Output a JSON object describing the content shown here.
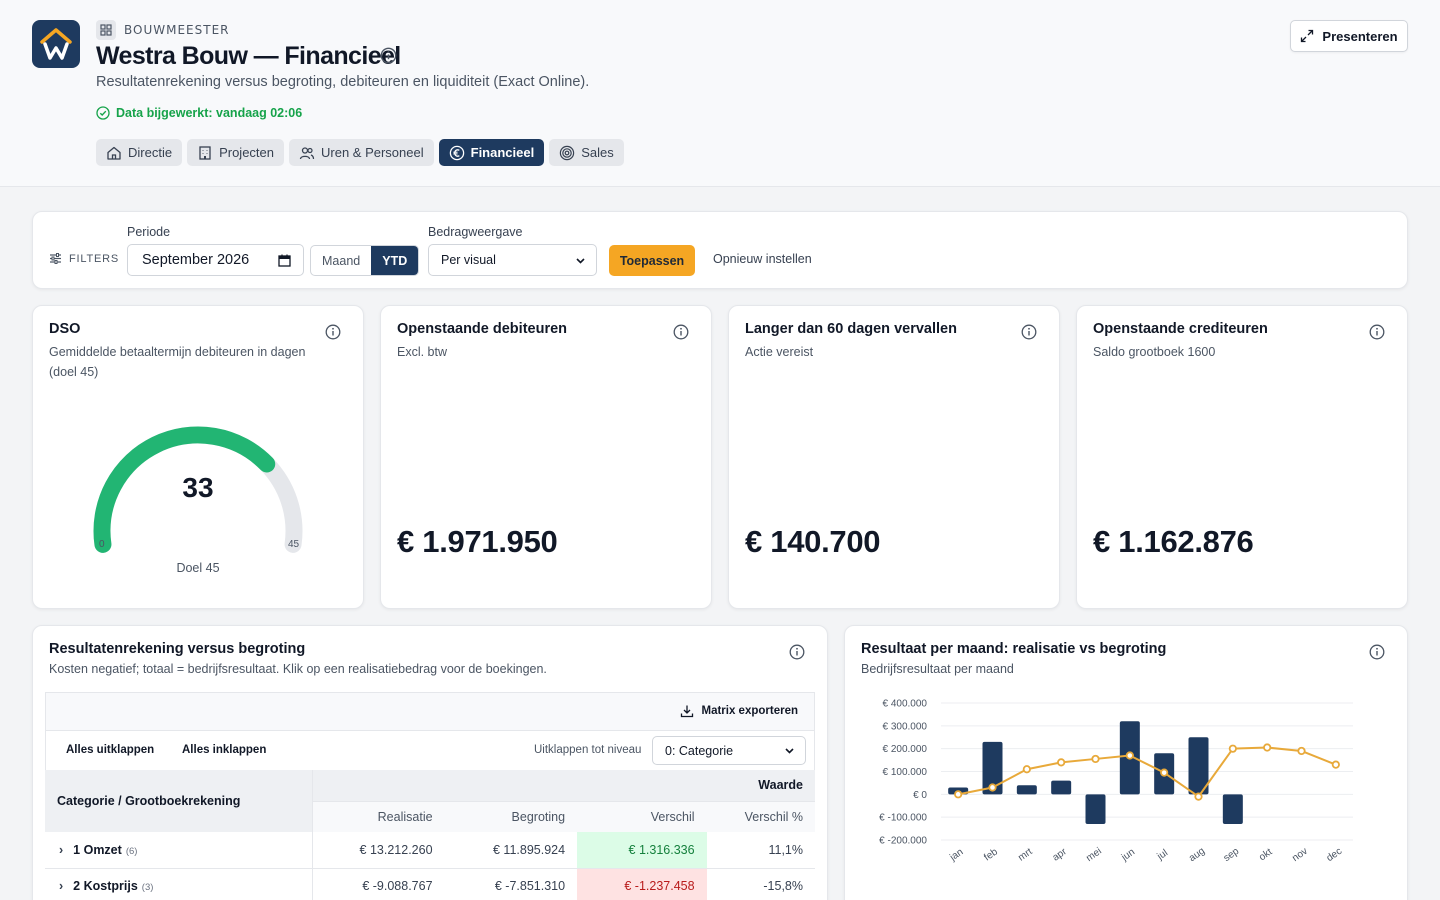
{
  "header": {
    "brand": "BOUWMEESTER",
    "title": "Westra Bouw — Financieel",
    "subtitle": "Resultatenrekening versus begroting, debiteuren en liquiditeit (Exact Online).",
    "updated": "Data bijgewerkt: vandaag 02:06",
    "present_label": "Presenteren",
    "tabs": [
      {
        "label": "Directie",
        "icon": "home-icon",
        "active": false
      },
      {
        "label": "Projecten",
        "icon": "building-icon",
        "active": false
      },
      {
        "label": "Uren & Personeel",
        "icon": "users-icon",
        "active": false
      },
      {
        "label": "Financieel",
        "icon": "euro-icon",
        "active": true
      },
      {
        "label": "Sales",
        "icon": "target-icon",
        "active": false
      }
    ]
  },
  "filters": {
    "label": "FILTERS",
    "period_label": "Periode",
    "period_value": "September 2026",
    "mode_options": [
      "Maand",
      "YTD"
    ],
    "mode_selected": "YTD",
    "amount_label": "Bedragweergave",
    "amount_value": "Per visual",
    "apply_label": "Toepassen",
    "reset_label": "Opnieuw instellen"
  },
  "kpis": {
    "dso": {
      "title": "DSO",
      "subtitle": "Gemiddelde betaaltermijn debiteuren in dagen (doel 45)",
      "value": "33",
      "min": "0",
      "max": "45",
      "target": "Doel 45",
      "fraction": 0.7333
    },
    "debiteuren": {
      "title": "Openstaande debiteuren",
      "subtitle": "Excl. btw",
      "value": "€ 1.971.950"
    },
    "vervallen": {
      "title": "Langer dan 60 dagen vervallen",
      "subtitle": "Actie vereist",
      "value": "€ 140.700"
    },
    "crediteuren": {
      "title": "Openstaande crediteuren",
      "subtitle": "Saldo grootboek 1600",
      "value": "€ 1.162.876"
    }
  },
  "matrix": {
    "title": "Resultatenrekening versus begroting",
    "subtitle": "Kosten negatief; totaal = bedrijfsresultaat. Klik op een realisatiebedrag voor de boekingen.",
    "export_label": "Matrix exporteren",
    "expand_all": "Alles uitklappen",
    "collapse_all": "Alles inklappen",
    "level_label": "Uitklappen tot niveau",
    "level_value": "0: Categorie",
    "col_category": "Categorie / Grootboekrekening",
    "col_group": "Waarde",
    "columns": [
      "Realisatie",
      "Begroting",
      "Verschil",
      "Verschil %"
    ],
    "rows": [
      {
        "name": "1 Omzet",
        "count": "(6)",
        "realisatie": "€ 13.212.260",
        "begroting": "€ 11.895.924",
        "verschil": "€ 1.316.336",
        "verschil_pct": "11,1%",
        "status": "pos"
      },
      {
        "name": "2 Kostprijs",
        "count": "(3)",
        "realisatie": "€ -9.088.767",
        "begroting": "€ -7.851.310",
        "verschil": "€ -1.237.458",
        "verschil_pct": "-15,8%",
        "status": "neg"
      }
    ]
  },
  "chart_card": {
    "title": "Resultaat per maand: realisatie vs begroting",
    "subtitle": "Bedrijfsresultaat per maand"
  },
  "chart_data": {
    "type": "bar",
    "categories": [
      "jan",
      "feb",
      "mrt",
      "apr",
      "mei",
      "jun",
      "jul",
      "aug",
      "sep",
      "okt",
      "nov",
      "dec"
    ],
    "ylim": [
      -200000,
      400000
    ],
    "yticks": [
      400000,
      300000,
      200000,
      100000,
      0,
      -100000,
      -200000
    ],
    "ytick_labels": [
      "€ 400.000",
      "€ 300.000",
      "€ 200.000",
      "€ 100.000",
      "€ 0",
      "€ -100.000",
      "€ -200.000"
    ],
    "series": [
      {
        "kind": "bar",
        "color": "#1e3a5f",
        "values": [
          30000,
          230000,
          40000,
          60000,
          -130000,
          320000,
          180000,
          250000,
          -130000,
          null,
          null,
          null
        ]
      },
      {
        "kind": "line",
        "color": "#e8a93a",
        "values": [
          0,
          30000,
          110000,
          140000,
          155000,
          170000,
          95000,
          -10000,
          200000,
          205000,
          190000,
          130000
        ]
      }
    ]
  }
}
